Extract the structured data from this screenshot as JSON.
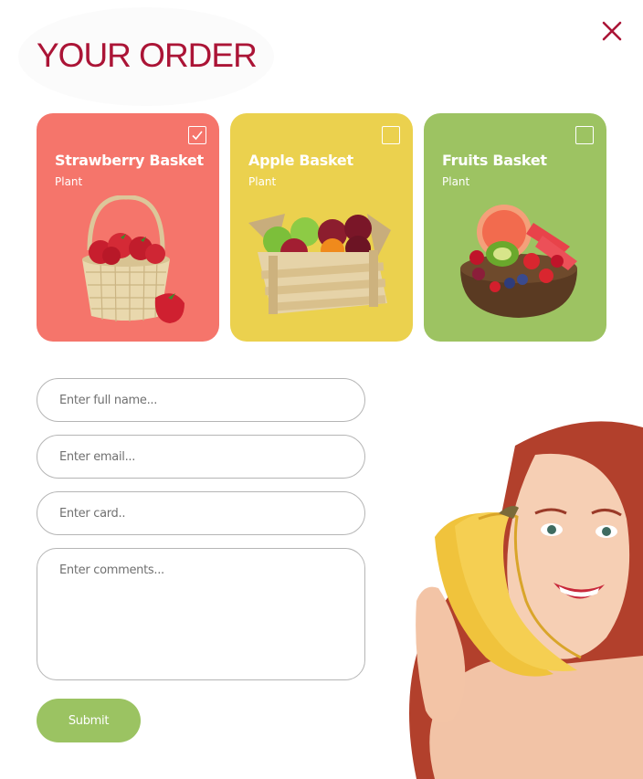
{
  "header": {
    "title": "YOUR ORDER",
    "close_icon": "close-icon"
  },
  "colors": {
    "accent": "#ab1436",
    "strawberry_card": "#f5756b",
    "apple_card": "#ebd14e",
    "fruits_card": "#9dc362",
    "submit": "#9bc362"
  },
  "products": [
    {
      "name": "Strawberry Basket",
      "category": "Plant",
      "selected": true
    },
    {
      "name": "Apple Basket",
      "category": "Plant",
      "selected": false
    },
    {
      "name": "Fruits Basket",
      "category": "Plant",
      "selected": false
    }
  ],
  "form": {
    "name_placeholder": "Enter full name...",
    "email_placeholder": "Enter email...",
    "card_placeholder": "Enter card..",
    "comments_placeholder": "Enter comments...",
    "submit_label": "Submit"
  }
}
